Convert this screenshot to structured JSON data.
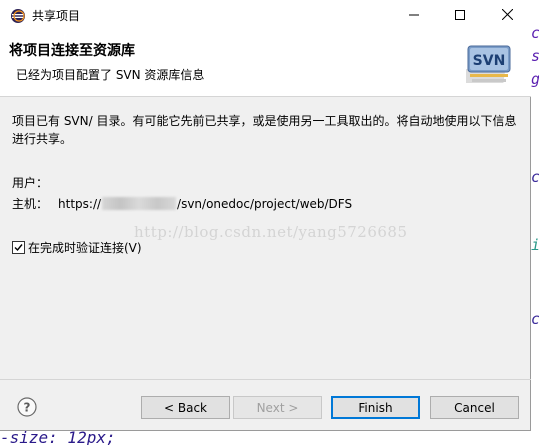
{
  "window": {
    "title": "共享项目",
    "app_icon": "eclipse-icon",
    "controls": {
      "minimize": "minimize-icon",
      "maximize": "maximize-icon",
      "close": "close-icon"
    }
  },
  "header": {
    "title": "将项目连接至资源库",
    "subtitle": "已经为项目配置了 SVN 资源库信息",
    "logo_text": "SVN"
  },
  "body": {
    "description": "项目已有 SVN/ 目录。有可能它先前已共享，或是使用另一工具取出的。将自动地使用以下信息进行共享。",
    "user_label": "用户：",
    "host_label": "主机：",
    "host_prefix": "https://",
    "host_suffix": "/svn/onedoc/project/web/DFS",
    "watermark": "http://blog.csdn.net/yang5726685",
    "validate_checkbox": {
      "label": "在完成时验证连接(V)",
      "checked": true
    }
  },
  "footer": {
    "help_icon": "help-icon",
    "back_label": "< Back",
    "next_label": "Next >",
    "finish_label": "Finish",
    "cancel_label": "Cancel"
  },
  "background": {
    "bottom_text": "-size: 12px;"
  },
  "colors": {
    "dialog_bg": "#f0f0f0",
    "header_bg": "#ffffff",
    "default_button_border": "#0078d7",
    "disabled_text": "#a0a0a0",
    "watermark": "#d4d4d4"
  }
}
